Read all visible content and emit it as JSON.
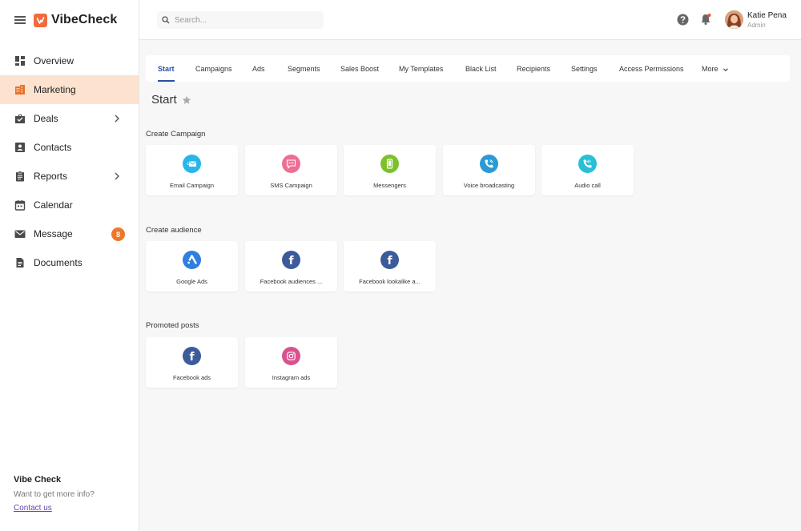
{
  "brand": {
    "name": "VibeCheck",
    "accent": "#f26a3d"
  },
  "nav": [
    {
      "label": "Overview",
      "icon": "dashboard-icon"
    },
    {
      "label": "Marketing",
      "icon": "building-icon",
      "active": true
    },
    {
      "label": "Deals",
      "icon": "briefcase-icon",
      "chevron": true
    },
    {
      "label": "Contacts",
      "icon": "contact-card-icon"
    },
    {
      "label": "Reports",
      "icon": "clipboard-icon",
      "chevron": true
    },
    {
      "label": "Calendar",
      "icon": "calendar-icon"
    },
    {
      "label": "Message",
      "icon": "mail-icon",
      "badge": "8"
    },
    {
      "label": "Documents",
      "icon": "document-icon"
    }
  ],
  "sidebar_footer": {
    "title": "Vibe Check",
    "subtitle": "Want to get more info?",
    "link": "Contact us"
  },
  "search": {
    "placeholder": "Search..."
  },
  "user": {
    "name": "Katie Pena",
    "role": "Admin"
  },
  "tabs": [
    "Start",
    "Campaigns",
    "Ads",
    "Segments",
    "Sales Boost",
    "My Templates",
    "Black List",
    "Recipients",
    "Settings",
    "Access Permissions",
    "More"
  ],
  "page_title": "Start",
  "sections": [
    {
      "title": "Create Campaign",
      "cards": [
        {
          "label": "Email Campaign",
          "icon": "email-icon",
          "color": "#29b5e8"
        },
        {
          "label": "SMS Campaign",
          "icon": "sms-icon",
          "color": "#ee6f94"
        },
        {
          "label": "Messengers",
          "icon": "phone-icon",
          "color": "#7cc12a"
        },
        {
          "label": "Voice broadcasting",
          "icon": "voice-call-icon",
          "color": "#2a9ad6"
        },
        {
          "label": "Audio call",
          "icon": "audio-call-icon",
          "color": "#27c0d6"
        }
      ]
    },
    {
      "title": "Create audience",
      "cards": [
        {
          "label": "Google Ads",
          "icon": "google-ads-icon",
          "color": "#2f7ee0"
        },
        {
          "label": "Facebook audiences ...",
          "icon": "facebook-icon",
          "color": "#3b5b9a"
        },
        {
          "label": "Facebook lookalike a...",
          "icon": "facebook-icon",
          "color": "#3b5b9a"
        }
      ]
    },
    {
      "title": "Promoted posts",
      "cards": [
        {
          "label": "Facebook ads",
          "icon": "facebook-icon",
          "color": "#3b5b9a"
        },
        {
          "label": "Instagram ads",
          "icon": "instagram-icon",
          "color": "#d9528e"
        }
      ]
    }
  ]
}
